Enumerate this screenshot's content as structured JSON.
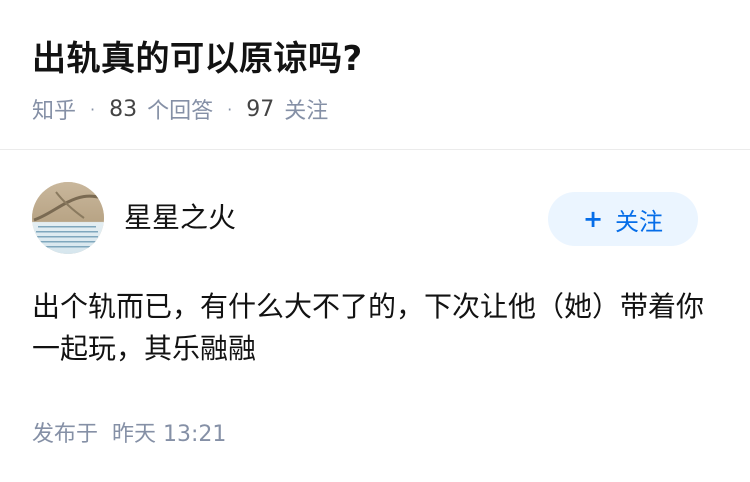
{
  "question": {
    "title": "出轨真的可以原谅吗?",
    "source": "知乎",
    "answer_count": "83",
    "answer_label": "个回答",
    "follower_count": "97",
    "follower_label": "关注",
    "separator": "·"
  },
  "answer": {
    "author_name": "星星之火",
    "follow_button": {
      "icon": "+",
      "label": "关注"
    },
    "content": "出个轨而已，有什么大不了的，下次让他（她）带着你一起玩，其乐融融",
    "published_label": "发布于",
    "published_time": "昨天 13:21"
  },
  "colors": {
    "title": "#121212",
    "meta": "#8590a6",
    "follow_button_bg": "#ebf5ff",
    "follow_button_text": "#056de8",
    "divider": "#ebebeb"
  }
}
